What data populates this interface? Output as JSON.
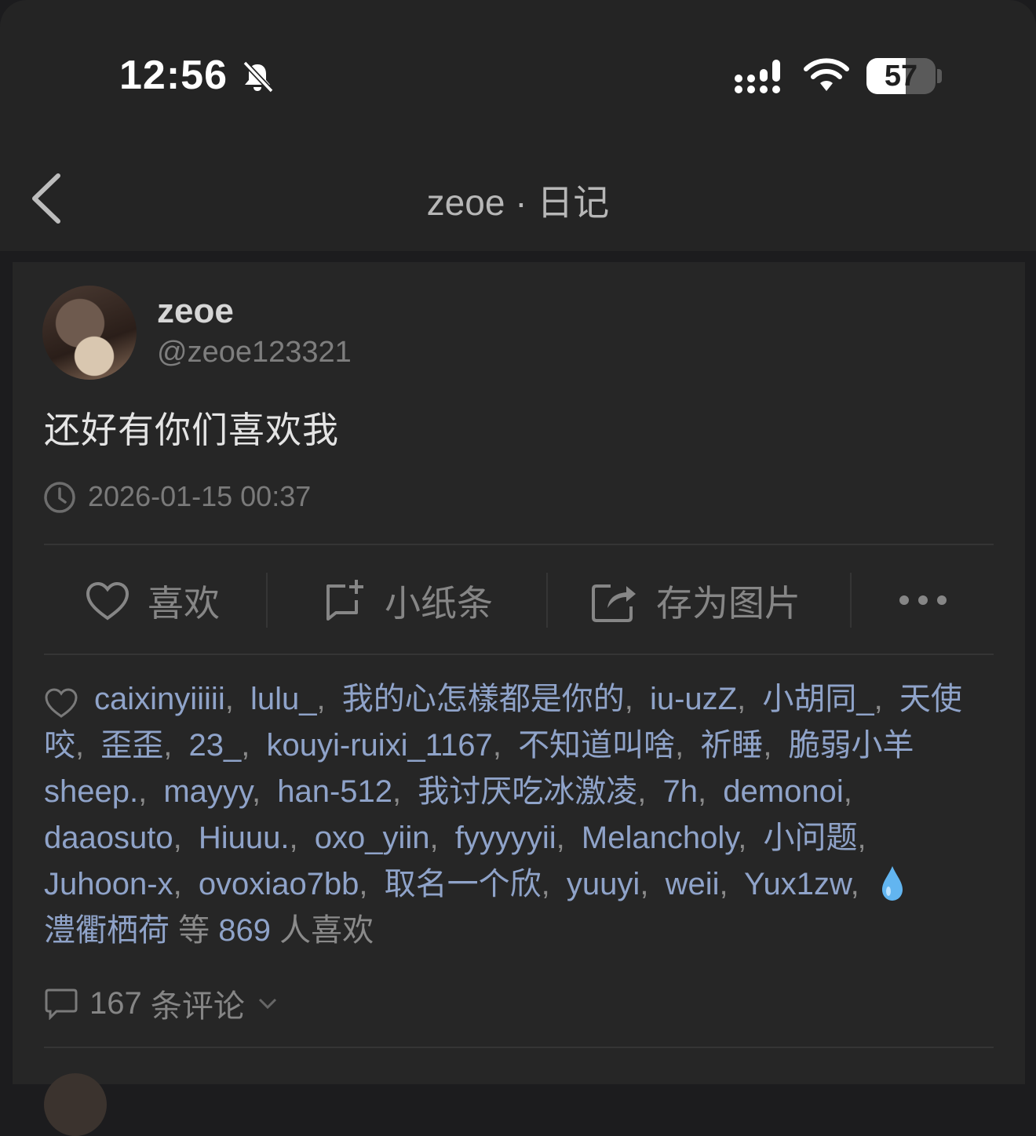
{
  "status_bar": {
    "time": "12:56",
    "battery": "57",
    "battery_level": 0.57,
    "icons": [
      "bell-slash-icon",
      "signal-icon",
      "wifi-icon",
      "battery-icon"
    ]
  },
  "nav": {
    "title": "zeoe · 日记",
    "back_icon": "chevron-left-icon"
  },
  "post": {
    "author_name": "zeoe",
    "author_handle": "@zeoe123321",
    "content": "还好有你们喜欢我",
    "timestamp": "2026-01-15 00:37",
    "actions": {
      "like": "喜欢",
      "note": "小纸条",
      "save_image": "存为图片"
    },
    "likers": [
      "caixinyiiiii",
      "lulu_",
      "我的心怎樣都是你的",
      "iu-uzZ",
      "小胡同_",
      "天使咬",
      "歪歪",
      "23_",
      "kouyi-ruixi_1167",
      "不知道叫啥",
      "祈睡",
      "脆弱小羊sheep.",
      "mayyy",
      "han-512",
      "我讨厌吃冰激凌",
      "7h",
      "demonoi",
      "daaosuto",
      "Hiuuu.",
      "oxo_yiin",
      "fyyyyyii",
      "Melancholy",
      "小问题",
      "Juhoon-x",
      "ovoxiao7bb",
      "取名一个欣",
      "yuuyi",
      "weii",
      "Yux1zw"
    ],
    "last_liker": "澧衢栖荷",
    "like_prefix": "等",
    "like_count": "869",
    "like_suffix": "人喜欢",
    "comment_count": "167",
    "comment_label": "条评论"
  },
  "colors": {
    "background": "#1c1c1e",
    "card": "#262626",
    "link": "#8fa3c9",
    "muted": "#7a7a7a"
  }
}
